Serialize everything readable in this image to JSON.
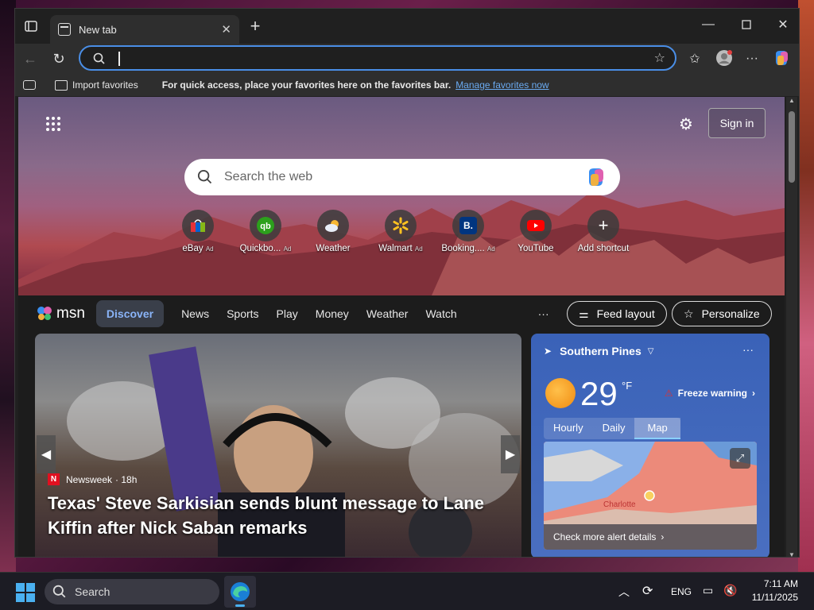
{
  "browser": {
    "tab_title": "New tab",
    "address_value": "",
    "import_favorites": "Import favorites",
    "favbar_message": "For quick access, place your favorites here on the favorites bar.",
    "favbar_link": "Manage favorites now"
  },
  "newtab": {
    "signin": "Sign in",
    "search_placeholder": "Search the web",
    "shortcuts": [
      {
        "label": "eBay",
        "ad": "Ad",
        "icon": "ebay-icon"
      },
      {
        "label": "Quickbo...",
        "ad": "Ad",
        "icon": "quickbooks-icon"
      },
      {
        "label": "Weather",
        "ad": "",
        "icon": "weather-icon"
      },
      {
        "label": "Walmart",
        "ad": "Ad",
        "icon": "walmart-icon"
      },
      {
        "label": "Booking....",
        "ad": "Ad",
        "icon": "booking-icon"
      },
      {
        "label": "YouTube",
        "ad": "",
        "icon": "youtube-icon"
      },
      {
        "label": "Add shortcut",
        "ad": "",
        "icon": "plus-icon"
      }
    ]
  },
  "msn": {
    "brand": "msn",
    "nav": [
      "Discover",
      "News",
      "Sports",
      "Play",
      "Money",
      "Weather",
      "Watch"
    ],
    "more": "···",
    "feed_layout": "Feed layout",
    "personalize": "Personalize"
  },
  "news": {
    "source": "Newsweek",
    "age": "· 18h",
    "headline": "Texas' Steve Sarkisian sends blunt message to Lane Kiffin after Nick Saban remarks"
  },
  "weather": {
    "location": "Southern Pines",
    "temp": "29",
    "unit": "°F",
    "alert": "Freeze warning",
    "tabs": [
      "Hourly",
      "Daily",
      "Map"
    ],
    "map_city": "Charlotte",
    "details_link": "Check more alert details"
  },
  "taskbar": {
    "search": "Search",
    "lang": "ENG",
    "time": "7:11 AM",
    "date": "11/11/2025"
  },
  "colors": {
    "accent": "#4a8ee6",
    "link": "#6aaaf0",
    "weather_card": "#3a62b8"
  }
}
